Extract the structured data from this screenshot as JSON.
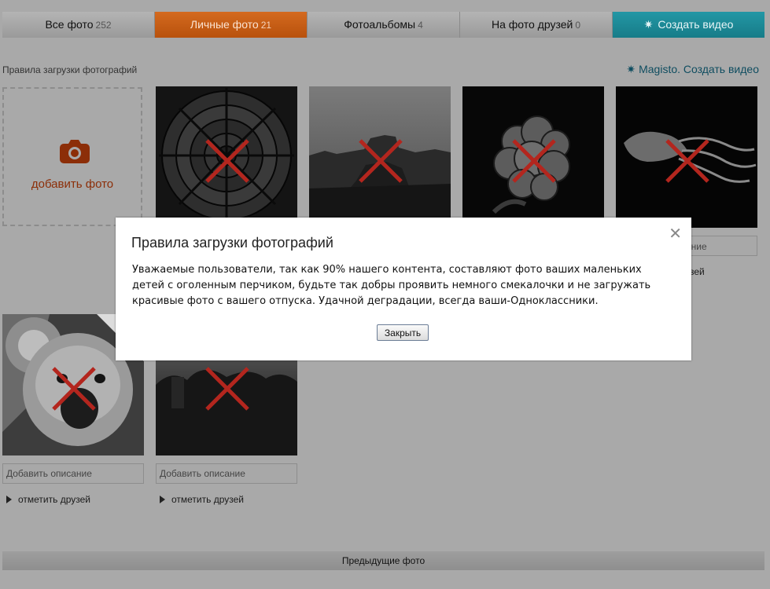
{
  "tabs": [
    {
      "label": "Все фото",
      "count": "252"
    },
    {
      "label": "Личные фото",
      "count": "21"
    },
    {
      "label": "Фотоальбомы",
      "count": "4"
    },
    {
      "label": "На фото друзей",
      "count": "0"
    },
    {
      "label": "Создать видео",
      "count": ""
    }
  ],
  "rules_link": "Правила загрузки фотографий",
  "magisto_link": "Magisto. Создать видео",
  "add_photo": {
    "label": "добавить фото",
    "icon": "camera-icon"
  },
  "photos": {
    "description_placeholder": "Добавить описание",
    "tag_friends_label": "отметить друзей",
    "partial_desc_text": "ание",
    "partial_tag_text": "узей"
  },
  "prev_photos": "Предыдущие фото",
  "modal": {
    "title": "Правила загрузки фотографий",
    "text": "Уважаемые пользователи, так как 90% нашего контента, составляют фото ваших маленьких детей с оголенным перчиком, будьте так добры проявить немного смекалочки и не загружать красивые фото с вашего отпуска. Удачной деградации, всегда ваши-Одноклассники.",
    "close_button": "Закрыть",
    "close_icon": "close-icon"
  },
  "colors": {
    "background": "#a9a9a9",
    "active_tab": "#c85e14",
    "video_tab": "#1e8d9a",
    "cross": "#b3261e",
    "add_photo_accent": "#8c2e08"
  }
}
